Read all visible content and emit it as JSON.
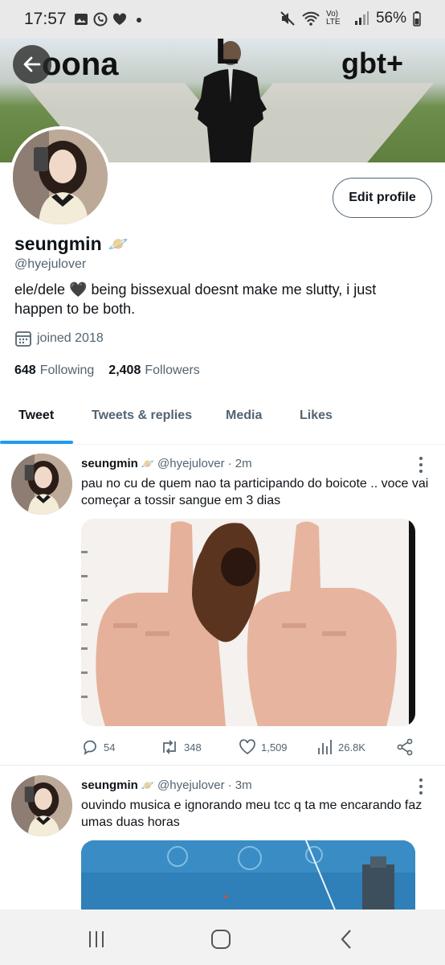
{
  "status": {
    "time": "17:57",
    "network": "Vo) LTE",
    "battery": "56%"
  },
  "banner": {
    "text_left": "oona",
    "text_right": "gbt+",
    "text_top": "L"
  },
  "profile": {
    "display_name": "seungmin",
    "name_emoji": "🪐",
    "handle": "@hyejulover",
    "bio": "ele/dele 🖤 being bissexual doesnt make me slutty, i just happen to be both.",
    "joined": "joined 2018",
    "following_count": "648",
    "following_label": "Following",
    "followers_count": "2,408",
    "followers_label": "Followers",
    "edit_profile_label": "Edit profile"
  },
  "tabs": [
    {
      "label": "Tweet",
      "active": true
    },
    {
      "label": "Tweets & replies",
      "active": false
    },
    {
      "label": "Media",
      "active": false
    },
    {
      "label": "Likes",
      "active": false
    }
  ],
  "tweets": [
    {
      "name": "seungmin",
      "emoji": "🪐",
      "handle": "@hyejulover",
      "time": "· 2m",
      "text": "pau no cu de quem nao ta participando do boicote .. voce vai começar a tossir sangue em 3 dias",
      "replies": "54",
      "retweets": "348",
      "likes": "1,509",
      "views": "26.8K"
    },
    {
      "name": "seungmin",
      "emoji": "🪐",
      "handle": "@hyejulover",
      "time": "· 3m",
      "text": "ouvindo musica e ignorando meu tcc q ta me encarando faz umas duas horas"
    }
  ],
  "colors": {
    "accent": "#1d9bf0",
    "text_primary": "#0f1419",
    "text_secondary": "#536471"
  }
}
